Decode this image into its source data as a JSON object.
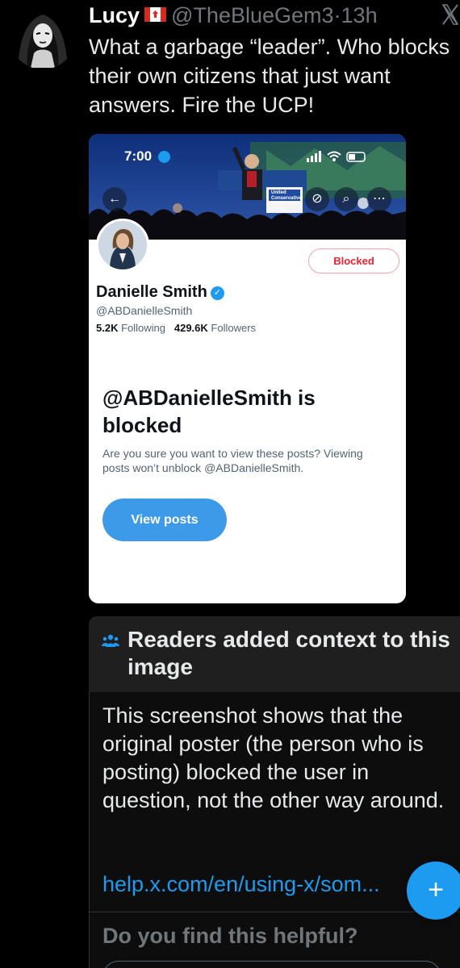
{
  "tweet": {
    "author_name": "Lucy",
    "flag_icon": "canada-flag-icon",
    "handle": "@TheBlueGem3",
    "separator": "·",
    "time": "13h",
    "close_icon": "x-close-icon",
    "text": "What a garbage “leader”. Who blocks their own citizens that just want answers. Fire the UCP!"
  },
  "embedded_screenshot": {
    "status_time": "7:00",
    "banner_sign": "United Conservative",
    "banner_sign_sub": "Alberta Strong & Free",
    "profile": {
      "name": "Danielle Smith",
      "handle": "@ABDanielleSmith",
      "following_count": "5.2K",
      "following_label": "Following",
      "followers_count": "429.6K",
      "followers_label": "Followers",
      "blocked_button": "Blocked"
    },
    "blocked_title": "@ABDanielleSmith is blocked",
    "blocked_description": "Are you sure you want to view these posts? Viewing posts won’t unblock @ABDanielleSmith.",
    "view_posts_button": "View posts"
  },
  "community_note": {
    "title": "Readers added context to this image",
    "body": "This screenshot shows that the original poster (the person who is posting) blocked the user in question, not the other way around.",
    "link": "help.x.com/en/using-x/som...",
    "helpful_question": "Do you find this helpful?"
  },
  "fab": {
    "label": "+"
  },
  "colors": {
    "background": "#000000",
    "accent": "#1d9bf0",
    "blocked_red": "#f4212e",
    "muted": "#71767b"
  }
}
